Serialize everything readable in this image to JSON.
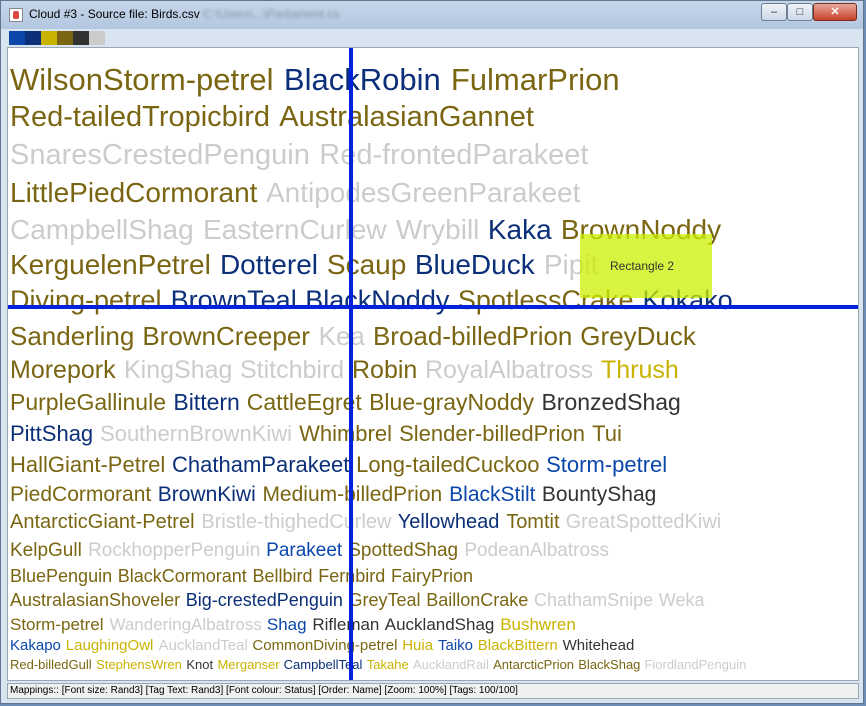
{
  "window": {
    "title": "Cloud #3 - Source file: Birds.csv",
    "title_suffix": "C:\\Users\\...\\Parliament.cs",
    "buttons": {
      "minimize": "–",
      "maximize": "□",
      "close": "✕"
    }
  },
  "palette": [
    "#0b47ab",
    "#0b2f78",
    "#c9b300",
    "#7a6612",
    "#333333",
    "#cccccc"
  ],
  "colors": {
    "olive": "#7a6612",
    "navy": "#0b2f78",
    "blue": "#0b47ab",
    "yellow": "#c9b300",
    "gray": "#cccccc",
    "dark": "#333333",
    "selection_lines": "#0022dd",
    "rectangle_fill": "#ccf000"
  },
  "overlay": {
    "rectangle_label": "Rectangle 2"
  },
  "status": {
    "mappings": "Mappings:: [Font size: Rand3]  [Tag Text: Rand3]  [Font colour: Status]  [Order: Name]  [Zoom: 100%]  [Tags: 100/100]"
  },
  "tags": [
    {
      "t": "WilsonStorm-petrel",
      "c": "olive"
    },
    {
      "t": "BlackRobin",
      "c": "navy"
    },
    {
      "t": "FulmarPrion",
      "c": "olive"
    },
    {
      "t": "Red-tailedTropicbird",
      "c": "olive"
    },
    {
      "t": "AustralasianGannet",
      "c": "olive"
    },
    {
      "t": "SnaresCrestedPenguin",
      "c": "gray"
    },
    {
      "t": "Red-frontedParakeet",
      "c": "gray"
    },
    {
      "t": "LittlePiedCormorant",
      "c": "olive"
    },
    {
      "t": "AntipodesGreenParakeet",
      "c": "gray"
    },
    {
      "t": "CampbellShag",
      "c": "gray"
    },
    {
      "t": "EasternCurlew",
      "c": "gray"
    },
    {
      "t": "Wrybill",
      "c": "gray"
    },
    {
      "t": "Kaka",
      "c": "navy"
    },
    {
      "t": "BrownNoddy",
      "c": "olive"
    },
    {
      "t": "KerguelenPetrel",
      "c": "olive"
    },
    {
      "t": "Dotterel",
      "c": "navy"
    },
    {
      "t": "Scaup",
      "c": "olive"
    },
    {
      "t": "BlueDuck",
      "c": "navy"
    },
    {
      "t": "Pipit",
      "c": "gray"
    },
    {
      "t": "Diving-petrel",
      "c": "olive"
    },
    {
      "t": "BrownTeal",
      "c": "navy"
    },
    {
      "t": "BlackNoddy",
      "c": "navy"
    },
    {
      "t": "SpotlessCrake",
      "c": "olive"
    },
    {
      "t": "Kokako",
      "c": "navy"
    },
    {
      "t": "Sanderling",
      "c": "olive"
    },
    {
      "t": "BrownCreeper",
      "c": "olive"
    },
    {
      "t": "Kea",
      "c": "gray"
    },
    {
      "t": "Broad-billedPrion",
      "c": "olive"
    },
    {
      "t": "GreyDuck",
      "c": "olive"
    },
    {
      "t": "Morepork",
      "c": "olive"
    },
    {
      "t": "KingShag",
      "c": "gray"
    },
    {
      "t": "Stitchbird",
      "c": "gray"
    },
    {
      "t": "Robin",
      "c": "olive"
    },
    {
      "t": "RoyalAlbatross",
      "c": "gray"
    },
    {
      "t": "Thrush",
      "c": "yellow"
    },
    {
      "t": "PurpleGallinule",
      "c": "olive"
    },
    {
      "t": "Bittern",
      "c": "navy"
    },
    {
      "t": "CattleEgret",
      "c": "olive"
    },
    {
      "t": "Blue-grayNoddy",
      "c": "olive"
    },
    {
      "t": "BronzedShag",
      "c": "dark"
    },
    {
      "t": "PittShag",
      "c": "navy"
    },
    {
      "t": "SouthernBrownKiwi",
      "c": "gray"
    },
    {
      "t": "Whimbrel",
      "c": "olive"
    },
    {
      "t": "Slender-billedPrion",
      "c": "olive"
    },
    {
      "t": "Tui",
      "c": "olive"
    },
    {
      "t": "HallGiant-Petrel",
      "c": "olive"
    },
    {
      "t": "ChathamParakeet",
      "c": "navy"
    },
    {
      "t": "Long-tailedCuckoo",
      "c": "olive"
    },
    {
      "t": "Storm-petrel",
      "c": "blue"
    },
    {
      "t": "PiedCormorant",
      "c": "olive"
    },
    {
      "t": "BrownKiwi",
      "c": "navy"
    },
    {
      "t": "Medium-billedPrion",
      "c": "olive"
    },
    {
      "t": "BlackStilt",
      "c": "blue"
    },
    {
      "t": "BountyShag",
      "c": "dark"
    },
    {
      "t": "AntarcticGiant-Petrel",
      "c": "olive"
    },
    {
      "t": "Bristle-thighedCurlew",
      "c": "gray"
    },
    {
      "t": "Yellowhead",
      "c": "navy"
    },
    {
      "t": "Tomtit",
      "c": "olive"
    },
    {
      "t": "GreatSpottedKiwi",
      "c": "gray"
    },
    {
      "t": "KelpGull",
      "c": "olive"
    },
    {
      "t": "RockhopperPenguin",
      "c": "gray"
    },
    {
      "t": "Parakeet",
      "c": "blue"
    },
    {
      "t": "SpottedShag",
      "c": "olive"
    },
    {
      "t": "PodeanAlbatross",
      "c": "gray"
    },
    {
      "t": "BluePenguin",
      "c": "olive"
    },
    {
      "t": "BlackCormorant",
      "c": "olive"
    },
    {
      "t": "Bellbird",
      "c": "olive"
    },
    {
      "t": "Fernbird",
      "c": "olive"
    },
    {
      "t": "FairyPrion",
      "c": "olive"
    },
    {
      "t": "AustralasianShoveler",
      "c": "olive"
    },
    {
      "t": "Big-crestedPenguin",
      "c": "navy"
    },
    {
      "t": "GreyTeal",
      "c": "olive"
    },
    {
      "t": "BaillonCrake",
      "c": "olive"
    },
    {
      "t": "ChathamSnipe",
      "c": "gray"
    },
    {
      "t": "Weka",
      "c": "gray"
    },
    {
      "t": "Storm-petrel",
      "c": "olive"
    },
    {
      "t": "WanderingAlbatross",
      "c": "gray"
    },
    {
      "t": "Shag",
      "c": "blue"
    },
    {
      "t": "Rifleman",
      "c": "dark"
    },
    {
      "t": "AucklandShag",
      "c": "dark"
    },
    {
      "t": "Bushwren",
      "c": "yellow"
    },
    {
      "t": "Kakapo",
      "c": "blue"
    },
    {
      "t": "LaughingOwl",
      "c": "yellow"
    },
    {
      "t": "AucklandTeal",
      "c": "gray"
    },
    {
      "t": "CommonDiving-petrel",
      "c": "olive"
    },
    {
      "t": "Huia",
      "c": "yellow"
    },
    {
      "t": "Taiko",
      "c": "blue"
    },
    {
      "t": "BlackBittern",
      "c": "yellow"
    },
    {
      "t": "Whitehead",
      "c": "dark"
    },
    {
      "t": "Red-billedGull",
      "c": "olive"
    },
    {
      "t": "StephensWren",
      "c": "yellow"
    },
    {
      "t": "Knot",
      "c": "dark"
    },
    {
      "t": "Merganser",
      "c": "yellow"
    },
    {
      "t": "CampbellTeal",
      "c": "navy"
    },
    {
      "t": "Takahe",
      "c": "yellow"
    },
    {
      "t": "AucklandRail",
      "c": "gray"
    },
    {
      "t": "AntarcticPrion",
      "c": "olive"
    },
    {
      "t": "BlackShag",
      "c": "olive"
    },
    {
      "t": "FiordlandPenguin",
      "c": "gray"
    }
  ]
}
